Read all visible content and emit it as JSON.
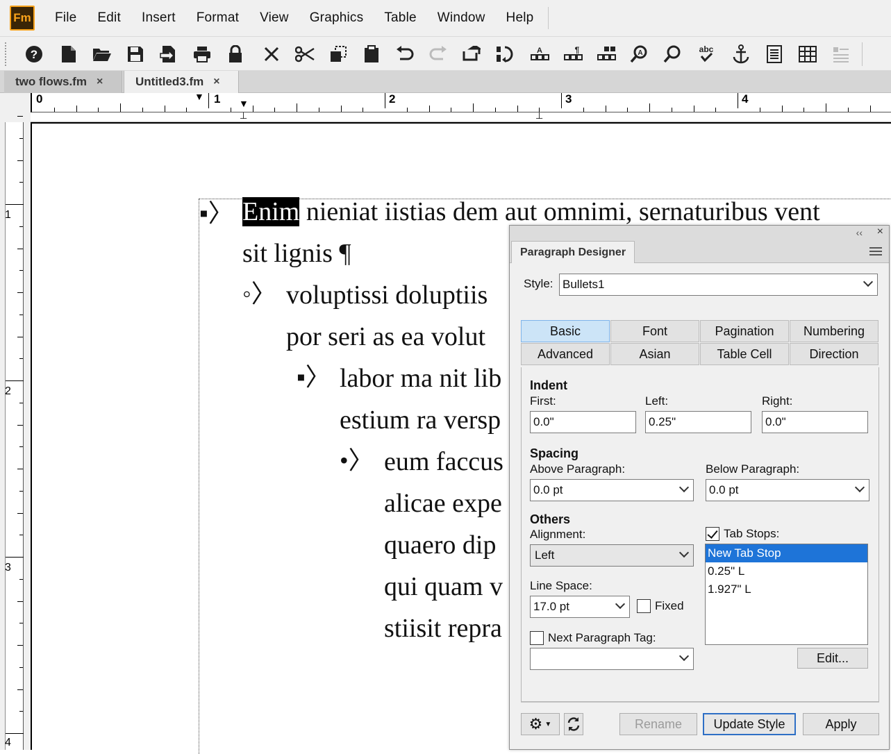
{
  "app": {
    "logo": "Fm"
  },
  "menu": [
    "File",
    "Edit",
    "Insert",
    "Format",
    "View",
    "Graphics",
    "Table",
    "Window",
    "Help"
  ],
  "toolbar_icons": [
    "help-icon",
    "new-document-icon",
    "open-folder-icon",
    "save-icon",
    "save-as-icon",
    "print-icon",
    "lock-icon",
    "delete-icon",
    "cut-icon",
    "copy-icon",
    "paste-icon",
    "undo-icon",
    "redo-icon",
    "repeat-icon",
    "text-flow-icon",
    "insert-variable-icon",
    "insert-marker-icon",
    "insert-table-icon",
    "find-replace-icon",
    "search-icon",
    "spelling-icon",
    "anchor-icon",
    "page-layout-icon",
    "table-grid-icon",
    "align-icon"
  ],
  "tabs": [
    {
      "label": "two flows.fm",
      "close": "×"
    },
    {
      "label": "Untitled3.fm",
      "close": "×"
    }
  ],
  "ruler": {
    "h_numbers": [
      "0",
      "1",
      "2",
      "3",
      "4"
    ],
    "v_numbers": [
      "1",
      "2",
      "3",
      "4"
    ]
  },
  "document": {
    "bullets": [
      "▪〉",
      "◦〉",
      "▪〉",
      "•〉"
    ],
    "selected_word": "Enim",
    "lines": [
      "nieniat iistias dem aut omnimi, sernaturibus vent",
      "sit lignis ¶",
      "voluptissi doluptiis",
      "por seri as ea volut",
      "labor ma nit lib",
      "estium ra versp",
      "eum faccus",
      "alicae expe",
      "quaero dip",
      "qui quam v",
      "stiisit repra"
    ]
  },
  "paragraph_designer": {
    "collapse": "‹‹",
    "close": "×",
    "title": "Paragraph Designer",
    "style_label": "Style:",
    "style_value": "Bullets1",
    "tabs": [
      "Basic",
      "Font",
      "Pagination",
      "Numbering",
      "Advanced",
      "Asian",
      "Table Cell",
      "Direction"
    ],
    "active_tab": "Basic",
    "indent": {
      "header": "Indent",
      "first_label": "First:",
      "first_value": "0.0\"",
      "left_label": "Left:",
      "left_value": "0.25\"",
      "right_label": "Right:",
      "right_value": "0.0\""
    },
    "spacing": {
      "header": "Spacing",
      "above_label": "Above Paragraph:",
      "above_value": "0.0 pt",
      "below_label": "Below Paragraph:",
      "below_value": "0.0 pt"
    },
    "others": {
      "header": "Others",
      "alignment_label": "Alignment:",
      "alignment_value": "Left",
      "line_space_label": "Line Space:",
      "line_space_value": "17.0 pt",
      "fixed_label": "Fixed",
      "fixed_checked": false,
      "next_tag_label": "Next Paragraph Tag:",
      "next_tag_checked": false,
      "next_tag_value": ""
    },
    "tab_stops": {
      "label": "Tab Stops:",
      "checked": true,
      "items": [
        "New Tab Stop",
        "0.25\"  L",
        "1.927\"  L"
      ],
      "edit_label": "Edit..."
    },
    "footer": {
      "rename": "Rename",
      "update_style": "Update Style",
      "apply": "Apply"
    }
  }
}
